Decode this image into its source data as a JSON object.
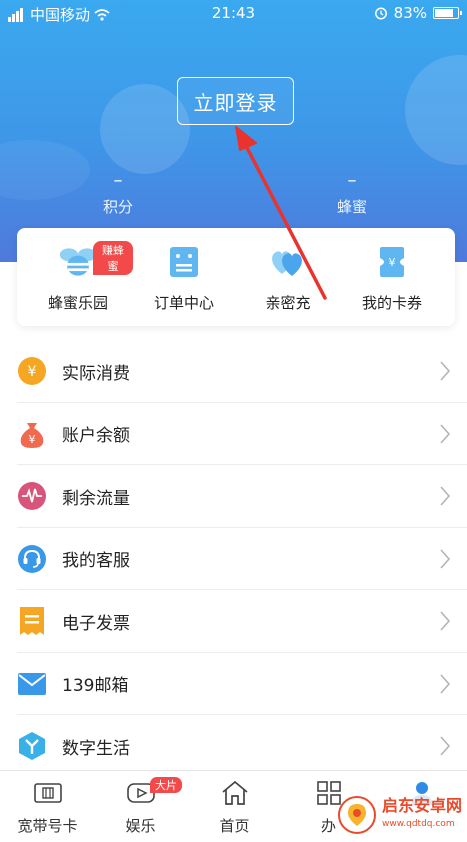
{
  "status": {
    "carrier": "中国移动",
    "time": "21:43",
    "battery": "83%",
    "battery_level": 0.83
  },
  "header": {
    "login_label": "立即登录",
    "stats": [
      {
        "value": "–",
        "label": "积分"
      },
      {
        "value": "–",
        "label": "蜂蜜"
      }
    ]
  },
  "quick": {
    "items": [
      {
        "label": "蜂蜜乐园",
        "icon": "bee-icon",
        "badge": "赚蜂蜜"
      },
      {
        "label": "订单中心",
        "icon": "order-icon"
      },
      {
        "label": "亲密充",
        "icon": "hearts-icon"
      },
      {
        "label": "我的卡券",
        "icon": "coupon-icon"
      }
    ]
  },
  "menu": {
    "items": [
      {
        "label": "实际消费",
        "icon": "yen-coin-icon",
        "color": "#f5a623"
      },
      {
        "label": "账户余额",
        "icon": "money-bag-icon",
        "color": "#ef6a4f"
      },
      {
        "label": "剩余流量",
        "icon": "pulse-icon",
        "color": "#d9547a"
      },
      {
        "label": "我的客服",
        "icon": "headset-icon",
        "color": "#3a98e8"
      },
      {
        "label": "电子发票",
        "icon": "invoice-icon",
        "color": "#f5a623"
      },
      {
        "label": "139邮箱",
        "icon": "mail-icon",
        "color": "#3a98e8"
      },
      {
        "label": "数字生活",
        "icon": "cube-icon",
        "color": "#3ab0e8"
      }
    ]
  },
  "tabbar": {
    "items": [
      {
        "label": "宽带号卡",
        "icon": "sim-card-icon"
      },
      {
        "label": "娱乐",
        "icon": "play-icon",
        "badge": "大片"
      },
      {
        "label": "首页",
        "icon": "home-icon"
      },
      {
        "label": "办",
        "icon": "grid-icon"
      },
      {
        "label": "",
        "icon": "profile-icon"
      }
    ]
  },
  "watermark": {
    "name": "启东安卓网",
    "url": "www.qdtdq.com"
  },
  "colors": {
    "header_top": "#3aa9ef",
    "header_bottom": "#4f79dc",
    "arrow": "#e8332f",
    "badge": "#f24a4a"
  }
}
